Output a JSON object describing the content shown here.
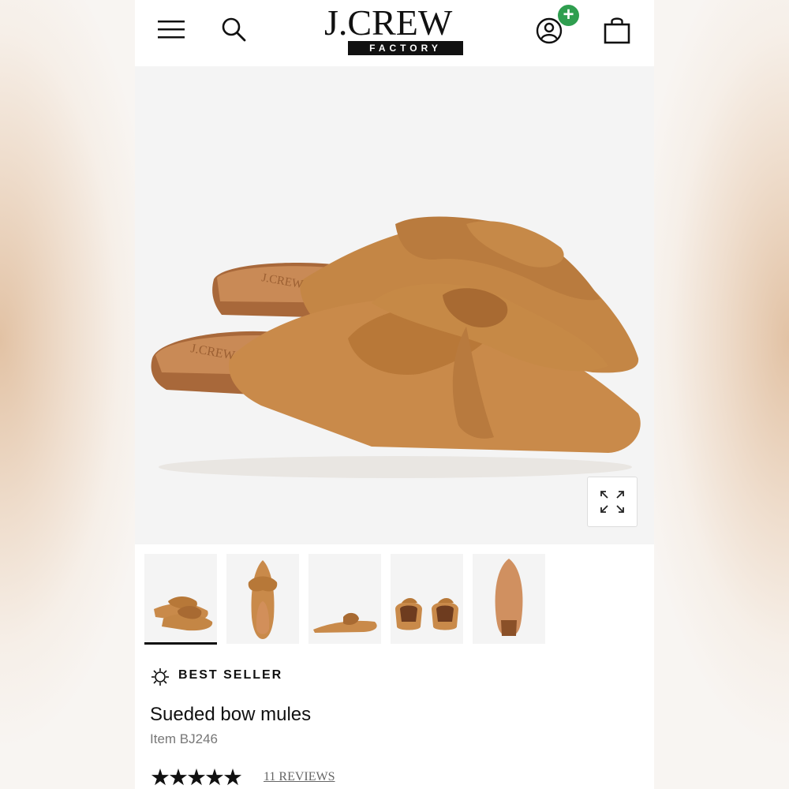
{
  "header": {
    "logo_main": "J.CREW",
    "logo_sub": "FACTORY",
    "badge": "+",
    "menu_icon": "hamburger-menu-icon",
    "search_icon": "search-icon",
    "account_icon": "account-icon",
    "bag_icon": "shopping-bag-icon"
  },
  "gallery": {
    "main_image": "tan sueded bow mules, pair",
    "expand_icon": "expand-arrows-icon",
    "thumbnails": [
      {
        "alt": "pair side view",
        "selected": true
      },
      {
        "alt": "top view"
      },
      {
        "alt": "side profile"
      },
      {
        "alt": "back view"
      },
      {
        "alt": "sole view"
      }
    ]
  },
  "product": {
    "badge_icon": "starburst-icon",
    "badge_label": "BEST SELLER",
    "title": "Sueded bow mules",
    "item_number": "Item BJ246",
    "stars": "★★★★★",
    "rating_value": 5,
    "reviews_link": "11 REVIEWS"
  },
  "colors": {
    "suede": "#c98a4a",
    "suede_dark": "#a86a32",
    "insole": "#c47a46",
    "badge_green": "#2f9e4f"
  }
}
